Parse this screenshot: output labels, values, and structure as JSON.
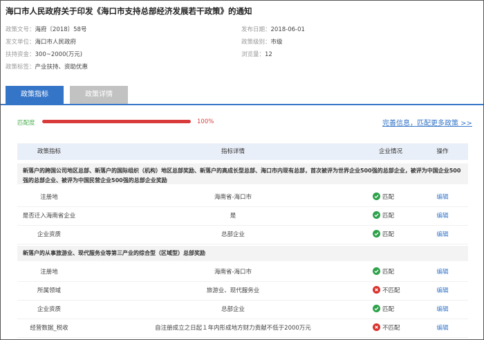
{
  "title": "海口市人民政府关于印发《海口市支持总部经济发展若干政策》的通知",
  "meta": {
    "doc_no_label": "政策文号：",
    "doc_no": "海府〔2018〕58号",
    "issuer_label": "发文单位：",
    "issuer": "海口市人民政府",
    "funding_label": "扶持资金：",
    "funding": "300~2000(万元)",
    "tags_label": "政策标签：",
    "tags": "产业扶持、资助优惠",
    "publish_date_label": "发布日期：",
    "publish_date": "2018-06-01",
    "level_label": "政策级别：",
    "level": "市级",
    "views_label": "浏览量：",
    "views": "12"
  },
  "tabs": [
    {
      "label": "政策指标",
      "active": true
    },
    {
      "label": "政策详情",
      "active": false
    }
  ],
  "match": {
    "label": "匹配度",
    "percent": 100,
    "percent_text": "100%",
    "more_link": "完善信息，匹配更多政策 >>"
  },
  "table": {
    "headers": [
      "政策指标",
      "指标详情",
      "企业情况",
      "操作"
    ],
    "groups": [
      {
        "title": "新落户的跨国公司地区总部、新落户的国际组织（机构）地区总部奖励、新落户的高成长型总部、海口市内现有总部，首次被评为世界企业500强的总部企业，被评为中国企业500强的总部企业、被评为中国民营企业500强的总部企业奖励",
        "rows": [
          {
            "indicator": "注册地",
            "detail": "海南省-海口市",
            "status": "匹配",
            "match": true,
            "action": "编辑"
          },
          {
            "indicator": "是否迁入海南省企业",
            "detail": "是",
            "status": "匹配",
            "match": true,
            "action": "编辑"
          },
          {
            "indicator": "企业资质",
            "detail": "总部企业",
            "status": "匹配",
            "match": true,
            "action": "编辑"
          }
        ]
      },
      {
        "title": "新落户的从事旅游业、现代服务业等第三产业的综合型（区域型）总部奖励",
        "rows": [
          {
            "indicator": "注册地",
            "detail": "海南省-海口市",
            "status": "匹配",
            "match": true,
            "action": "编辑"
          },
          {
            "indicator": "所属领域",
            "detail": "旅游业、现代服务业",
            "status": "不匹配",
            "match": false,
            "action": "编辑"
          },
          {
            "indicator": "企业资质",
            "detail": "总部企业",
            "status": "匹配",
            "match": true,
            "action": "编辑"
          },
          {
            "indicator": "经营数据_税收",
            "detail": "自注册成立之日起１年内形成地方财力贡献不低于2000万元",
            "status": "不匹配",
            "match": false,
            "action": "编辑"
          }
        ]
      }
    ]
  },
  "colors": {
    "accent": "#3575c8",
    "match_green": "#2ea24a",
    "mismatch_red": "#d9332e",
    "progress_red": "#d93a3a"
  }
}
